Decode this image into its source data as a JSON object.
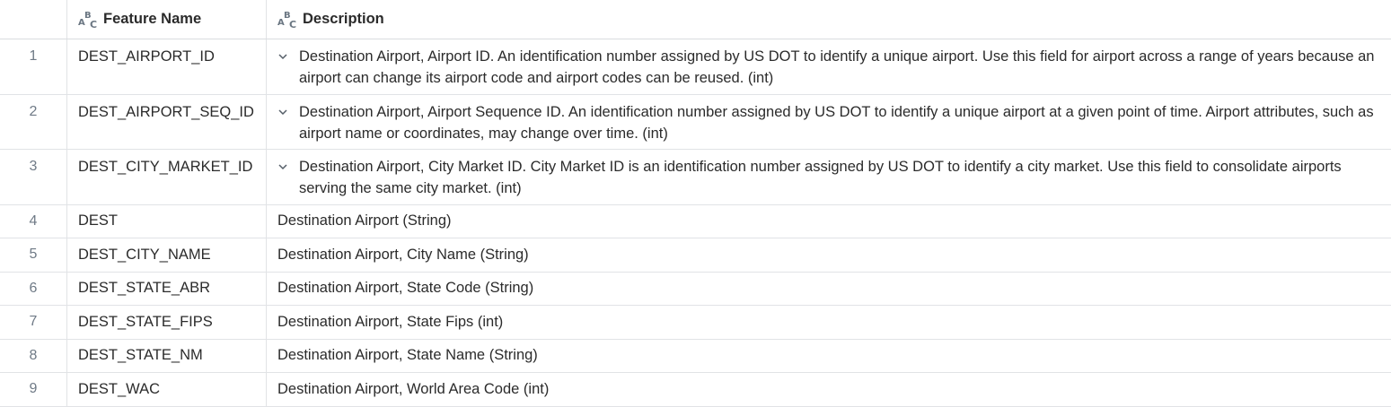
{
  "columns": {
    "name_header": "Feature Name",
    "desc_header": "Description",
    "type_icon": "abc-text-type-icon"
  },
  "rows": [
    {
      "num": "1",
      "name": "DEST_AIRPORT_ID",
      "expandable": true,
      "description": "Destination Airport, Airport ID. An identification number assigned by US DOT to identify a unique airport. Use this field for airport  across a range of years because an airport can change its airport code and airport codes can be reused. (int)"
    },
    {
      "num": "2",
      "name": "DEST_AIRPORT_SEQ_ID",
      "expandable": true,
      "description": "Destination Airport, Airport Sequence ID. An identification number assigned by US DOT to identify a unique airport at a given point of time. Airport attributes, such as airport name or coordinates, may change over time. (int)"
    },
    {
      "num": "3",
      "name": "DEST_CITY_MARKET_ID",
      "expandable": true,
      "description": "Destination Airport, City Market ID. City Market ID is an identification number assigned by US DOT to identify a city market. Use this field to consolidate airports serving the same city market. (int)"
    },
    {
      "num": "4",
      "name": "DEST",
      "expandable": false,
      "description": "Destination Airport (String)"
    },
    {
      "num": "5",
      "name": "DEST_CITY_NAME",
      "expandable": false,
      "description": "Destination Airport, City Name (String)"
    },
    {
      "num": "6",
      "name": "DEST_STATE_ABR",
      "expandable": false,
      "description": "Destination Airport, State Code (String)"
    },
    {
      "num": "7",
      "name": "DEST_STATE_FIPS",
      "expandable": false,
      "description": "Destination Airport, State Fips (int)"
    },
    {
      "num": "8",
      "name": "DEST_STATE_NM",
      "expandable": false,
      "description": "Destination Airport, State Name (String)"
    },
    {
      "num": "9",
      "name": "DEST_WAC",
      "expandable": false,
      "description": "Destination Airport, World Area Code (int)"
    }
  ]
}
